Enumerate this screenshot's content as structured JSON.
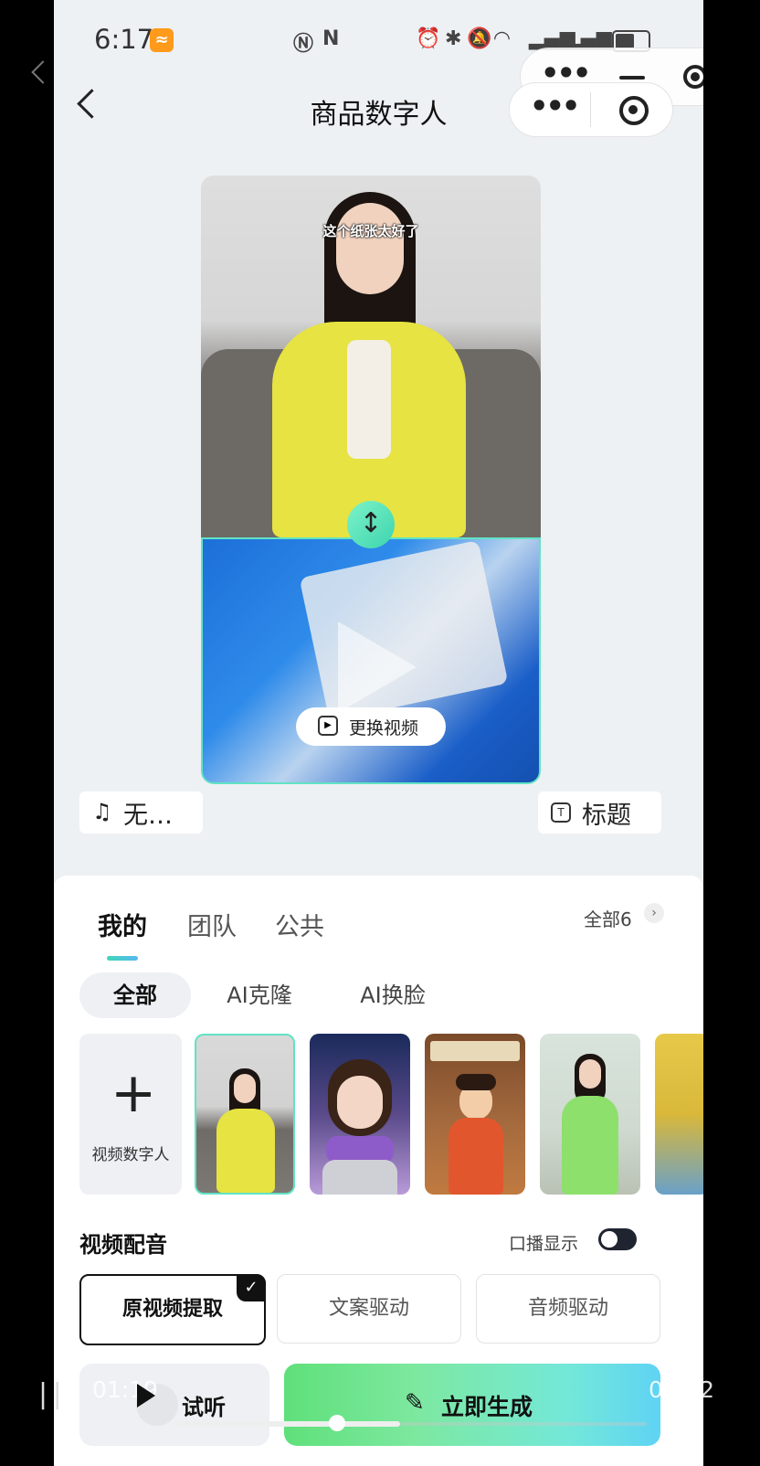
{
  "status_bar": {
    "time": "6:17",
    "badge_icon": "app-badge-icon",
    "left_icons": [
      "nfc-alt-icon",
      "nfc-icon"
    ],
    "right_icons": [
      "alarm-icon",
      "bluetooth-icon",
      "mute-icon",
      "wifi-icon",
      "signal-icon",
      "signal-icon",
      "battery-icon"
    ]
  },
  "header": {
    "title": "商品数字人",
    "back_icon": "back-arrow-icon",
    "menu_icon": "more-dots-icon",
    "close_icon": "target-close-icon"
  },
  "video": {
    "subtitle": "这个纸张太好了",
    "swap_icon": "vertical-swap-icon",
    "replace_label": "更换视频",
    "replace_icon": "replace-video-icon"
  },
  "chips": {
    "music_label": "无…",
    "music_icon": "music-note-icon",
    "title_label": "标题",
    "title_icon": "text-title-icon"
  },
  "tabs": {
    "items": [
      "我的",
      "团队",
      "公共"
    ],
    "active_index": 0,
    "all_count": "全部6"
  },
  "filters": {
    "items": [
      "全部",
      "AI克隆",
      "AI换脸"
    ],
    "active_index": 0
  },
  "avatars": {
    "add_label": "视频数字人",
    "thumbnails": [
      "yellow-suit-woman",
      "anime-girl-purple-scarf",
      "3d-ancient-lady",
      "green-dress-woman",
      "partial-avatar"
    ]
  },
  "voice": {
    "section_title": "视频配音",
    "oral_display_label": "口播显示",
    "oral_display_on": false,
    "options": [
      "原视频提取",
      "文案驱动",
      "音频驱动"
    ],
    "selected_index": 0
  },
  "actions": {
    "try_label": "试听",
    "generate_label": "立即生成",
    "generate_icon": "magic-wand-icon"
  },
  "overlay_player": {
    "current_time": "01:19",
    "total_time": "03:52",
    "progress_fraction": 0.34
  },
  "colors": {
    "accent_teal": "#3dd4b0",
    "generate_gradient_start": "#5fe07a",
    "generate_gradient_end": "#5fd3f4",
    "badge_orange": "#ff9a1a"
  }
}
